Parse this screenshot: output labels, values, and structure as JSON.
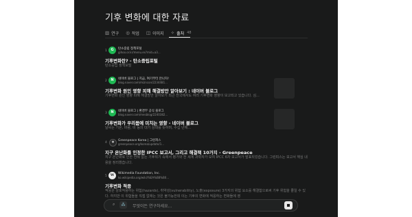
{
  "page": {
    "title": "기후 변화에 대한 자료"
  },
  "tabs": [
    {
      "label": "연구",
      "icon": "book-icon"
    },
    {
      "label": "작업",
      "icon": "task-icon"
    },
    {
      "label": "이미지",
      "icon": "image-icon"
    },
    {
      "label": "출처",
      "icon": "source-icon",
      "count": "48",
      "active": true
    }
  ],
  "results": [
    {
      "num": "1",
      "site": "탄소중립 정책포털",
      "url": "gihoo.or.kr/menu.es?mid=a3...",
      "title": "기후변화란? - 탄소중립포털",
      "snippet": "탄소중립 정책포털",
      "favicon": "G",
      "thumb": false
    },
    {
      "num": "2",
      "site": "네이버 블로그 | 지금, 여기부터 만나자!",
      "url": "blog.naver.com/mizncon/2234481...",
      "title": "기후변화 원인 영향 피해 해결방안 알아보기 : 네이버 블로그",
      "snippet": "기후변화 원인 영향 피해 해결방안 알아보기 최근 전국에서도 여러 기후변화 영향이 보고되고 있습니다. 심...",
      "favicon": "N",
      "thumb": true
    },
    {
      "num": "3",
      "site": "네이버 블로그 | 환경부 공식 블로그",
      "url": "blog.naver.com/mesblog/2240382...",
      "title": "기후변화가 우리몸에 미치는 영향 - 네이버 블로그",
      "snippet": "날씨는 기온, 바람, 비 등의 대기 상태를 뜻하며, 수십 년에...",
      "favicon": "N",
      "thumb": true
    },
    {
      "num": "4",
      "site": "Greenpeace Korea | 그린피스",
      "url": "greenpeace.org/korea/update/1...",
      "title": "지구 온난화를 인정한 IPCC 보고서, 그리고 해결책 10가지 - Greenpeace",
      "snippet": "지구 온난화로 인한 전례 없는 기후위기 속에서 평가와 전 세계 과학자가 모여 IPCC 6차 보고서가 발표되었습니다. 그린피스는 보고서 핵심 내용을 정리했습니다.",
      "favicon": "✱",
      "thumb": false
    },
    {
      "num": "5",
      "site": "Wikimedia Foundation, Inc.",
      "url": "ko.wikipedia.org/wiki/%EA%B8%B0...",
      "title": "기후변화 적응",
      "snippet": "적응은 상호작용하는 위험(hazards), 취약성(vulnerability), 노출(exposure) 3가지의 위험 요소를 해결함으로써 기후 위험을 줄일 수 있다. 하지만 이 위험들을 직접 없애는 것은 불가능한데 이는 기후의 변화에 적응하는 변화들에 영",
      "favicon": "W",
      "thumb": false
    }
  ],
  "input": {
    "placeholder": "무엇이든 연구하세요..."
  }
}
